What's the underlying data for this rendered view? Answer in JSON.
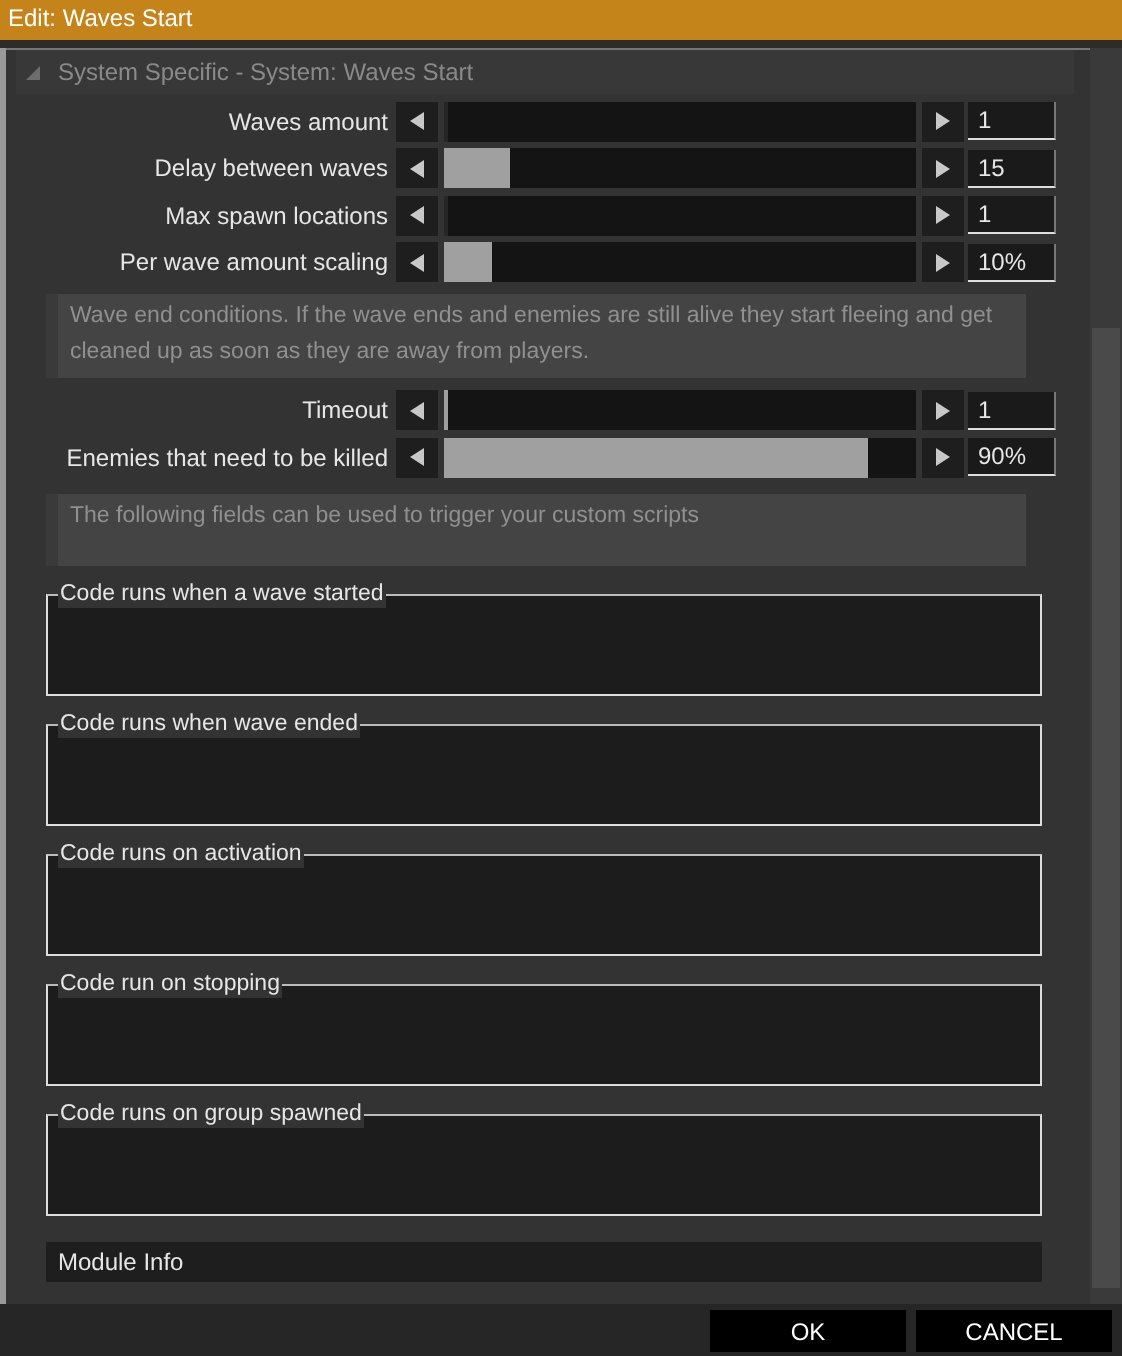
{
  "window": {
    "title": "Edit: Waves Start"
  },
  "section": {
    "title": "System Specific - System: Waves Start",
    "expanded": true
  },
  "sliders": [
    {
      "label": "Waves amount",
      "level": 0,
      "value": "1"
    },
    {
      "label": "Delay between waves",
      "level": 0.14,
      "value": "15"
    },
    {
      "label": "Max spawn locations",
      "level": 0,
      "value": "1"
    },
    {
      "label": "Per wave amount scaling",
      "level": 0.1,
      "value": "10%"
    }
  ],
  "end_conditions": {
    "note": "Wave end conditions. If the wave ends and enemies are still alive they start fleeing and get cleaned up as soon as they are away from players.",
    "sliders": [
      {
        "label": "Timeout",
        "level": 0.01,
        "value": "1"
      },
      {
        "label": "Enemies that need to be killed",
        "level": 0.9,
        "value": "90%"
      }
    ]
  },
  "scripts_note": "The following fields can be used to trigger your custom scripts",
  "code_fields": [
    {
      "label": "Code runs when a wave started"
    },
    {
      "label": "Code runs when wave ended"
    },
    {
      "label": "Code runs on activation"
    },
    {
      "label": "Code run on stopping"
    },
    {
      "label": "Code runs on group spawned"
    }
  ],
  "module_info": {
    "title": "Module Info"
  },
  "buttons": [
    "OK",
    "CANCEL"
  ]
}
